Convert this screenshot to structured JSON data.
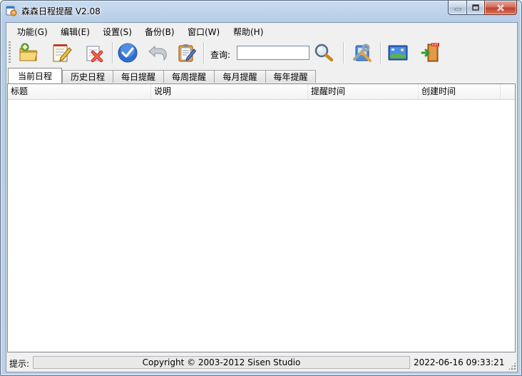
{
  "window": {
    "title": "森森日程提醒 V2.08"
  },
  "menu": [
    {
      "label": "功能(G)"
    },
    {
      "label": "编辑(E)"
    },
    {
      "label": "设置(S)"
    },
    {
      "label": "备份(B)"
    },
    {
      "label": "窗口(W)"
    },
    {
      "label": "帮助(H)"
    }
  ],
  "toolbar": {
    "buttons": [
      {
        "icon": "open-folder-icon"
      },
      {
        "icon": "edit-notepad-icon"
      },
      {
        "icon": "delete-icon"
      },
      {
        "icon": "complete-check-icon"
      },
      {
        "icon": "undo-icon"
      },
      {
        "icon": "clipboard-edit-icon"
      },
      {
        "icon": "settings-tools-icon"
      },
      {
        "icon": "desktop-icon"
      },
      {
        "icon": "exit-door-icon"
      }
    ],
    "query_label": "查询:",
    "query_value": "",
    "search_icon": "magnifier-icon"
  },
  "tabs": [
    {
      "label": "当前日程",
      "active": true
    },
    {
      "label": "历史日程"
    },
    {
      "label": "每日提醒"
    },
    {
      "label": "每周提醒"
    },
    {
      "label": "每月提醒"
    },
    {
      "label": "每年提醒"
    }
  ],
  "list": {
    "columns": [
      {
        "label": "标题"
      },
      {
        "label": "说明"
      },
      {
        "label": "提醒时间"
      },
      {
        "label": "创建时间"
      }
    ],
    "rows": []
  },
  "status": {
    "label": "提示:",
    "copyright": "Copyright © 2003-2012 Sisen Studio",
    "datetime": "2022-06-16 09:33:21"
  },
  "colors": {
    "accent": "#2f6fd0",
    "close": "#c1402c"
  }
}
